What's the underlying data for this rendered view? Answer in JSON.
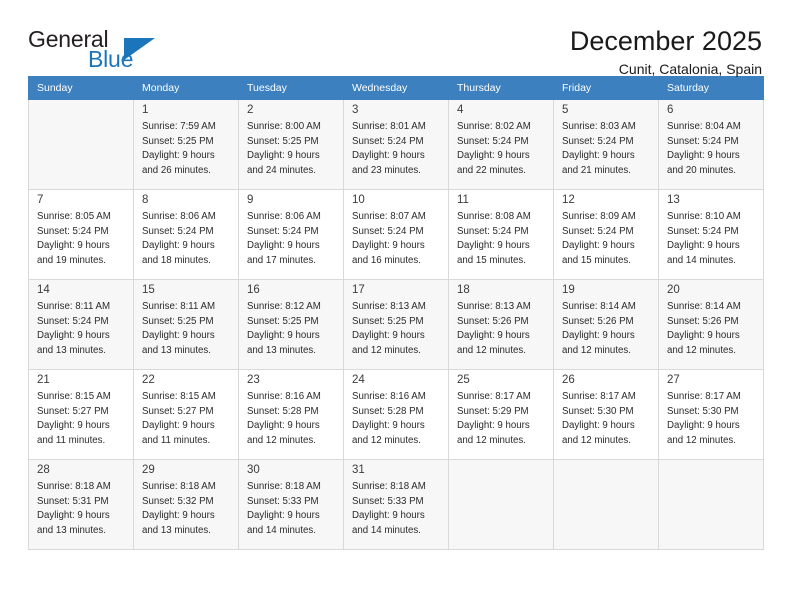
{
  "brand": {
    "name_top": "General",
    "name_bottom": "Blue",
    "accent_color": "#1b75bb"
  },
  "header": {
    "title": "December 2025",
    "subtitle": "Cunit, Catalonia, Spain"
  },
  "calendar": {
    "header_bg": "#3c80c0",
    "weekday_headers": [
      "Sunday",
      "Monday",
      "Tuesday",
      "Wednesday",
      "Thursday",
      "Friday",
      "Saturday"
    ],
    "weeks": [
      [
        {
          "day": ""
        },
        {
          "day": "1",
          "sunrise": "Sunrise: 7:59 AM",
          "sunset": "Sunset: 5:25 PM",
          "daylight_line1": "Daylight: 9 hours",
          "daylight_line2": "and 26 minutes."
        },
        {
          "day": "2",
          "sunrise": "Sunrise: 8:00 AM",
          "sunset": "Sunset: 5:25 PM",
          "daylight_line1": "Daylight: 9 hours",
          "daylight_line2": "and 24 minutes."
        },
        {
          "day": "3",
          "sunrise": "Sunrise: 8:01 AM",
          "sunset": "Sunset: 5:24 PM",
          "daylight_line1": "Daylight: 9 hours",
          "daylight_line2": "and 23 minutes."
        },
        {
          "day": "4",
          "sunrise": "Sunrise: 8:02 AM",
          "sunset": "Sunset: 5:24 PM",
          "daylight_line1": "Daylight: 9 hours",
          "daylight_line2": "and 22 minutes."
        },
        {
          "day": "5",
          "sunrise": "Sunrise: 8:03 AM",
          "sunset": "Sunset: 5:24 PM",
          "daylight_line1": "Daylight: 9 hours",
          "daylight_line2": "and 21 minutes."
        },
        {
          "day": "6",
          "sunrise": "Sunrise: 8:04 AM",
          "sunset": "Sunset: 5:24 PM",
          "daylight_line1": "Daylight: 9 hours",
          "daylight_line2": "and 20 minutes."
        }
      ],
      [
        {
          "day": "7",
          "sunrise": "Sunrise: 8:05 AM",
          "sunset": "Sunset: 5:24 PM",
          "daylight_line1": "Daylight: 9 hours",
          "daylight_line2": "and 19 minutes."
        },
        {
          "day": "8",
          "sunrise": "Sunrise: 8:06 AM",
          "sunset": "Sunset: 5:24 PM",
          "daylight_line1": "Daylight: 9 hours",
          "daylight_line2": "and 18 minutes."
        },
        {
          "day": "9",
          "sunrise": "Sunrise: 8:06 AM",
          "sunset": "Sunset: 5:24 PM",
          "daylight_line1": "Daylight: 9 hours",
          "daylight_line2": "and 17 minutes."
        },
        {
          "day": "10",
          "sunrise": "Sunrise: 8:07 AM",
          "sunset": "Sunset: 5:24 PM",
          "daylight_line1": "Daylight: 9 hours",
          "daylight_line2": "and 16 minutes."
        },
        {
          "day": "11",
          "sunrise": "Sunrise: 8:08 AM",
          "sunset": "Sunset: 5:24 PM",
          "daylight_line1": "Daylight: 9 hours",
          "daylight_line2": "and 15 minutes."
        },
        {
          "day": "12",
          "sunrise": "Sunrise: 8:09 AM",
          "sunset": "Sunset: 5:24 PM",
          "daylight_line1": "Daylight: 9 hours",
          "daylight_line2": "and 15 minutes."
        },
        {
          "day": "13",
          "sunrise": "Sunrise: 8:10 AM",
          "sunset": "Sunset: 5:24 PM",
          "daylight_line1": "Daylight: 9 hours",
          "daylight_line2": "and 14 minutes."
        }
      ],
      [
        {
          "day": "14",
          "sunrise": "Sunrise: 8:11 AM",
          "sunset": "Sunset: 5:24 PM",
          "daylight_line1": "Daylight: 9 hours",
          "daylight_line2": "and 13 minutes."
        },
        {
          "day": "15",
          "sunrise": "Sunrise: 8:11 AM",
          "sunset": "Sunset: 5:25 PM",
          "daylight_line1": "Daylight: 9 hours",
          "daylight_line2": "and 13 minutes."
        },
        {
          "day": "16",
          "sunrise": "Sunrise: 8:12 AM",
          "sunset": "Sunset: 5:25 PM",
          "daylight_line1": "Daylight: 9 hours",
          "daylight_line2": "and 13 minutes."
        },
        {
          "day": "17",
          "sunrise": "Sunrise: 8:13 AM",
          "sunset": "Sunset: 5:25 PM",
          "daylight_line1": "Daylight: 9 hours",
          "daylight_line2": "and 12 minutes."
        },
        {
          "day": "18",
          "sunrise": "Sunrise: 8:13 AM",
          "sunset": "Sunset: 5:26 PM",
          "daylight_line1": "Daylight: 9 hours",
          "daylight_line2": "and 12 minutes."
        },
        {
          "day": "19",
          "sunrise": "Sunrise: 8:14 AM",
          "sunset": "Sunset: 5:26 PM",
          "daylight_line1": "Daylight: 9 hours",
          "daylight_line2": "and 12 minutes."
        },
        {
          "day": "20",
          "sunrise": "Sunrise: 8:14 AM",
          "sunset": "Sunset: 5:26 PM",
          "daylight_line1": "Daylight: 9 hours",
          "daylight_line2": "and 12 minutes."
        }
      ],
      [
        {
          "day": "21",
          "sunrise": "Sunrise: 8:15 AM",
          "sunset": "Sunset: 5:27 PM",
          "daylight_line1": "Daylight: 9 hours",
          "daylight_line2": "and 11 minutes."
        },
        {
          "day": "22",
          "sunrise": "Sunrise: 8:15 AM",
          "sunset": "Sunset: 5:27 PM",
          "daylight_line1": "Daylight: 9 hours",
          "daylight_line2": "and 11 minutes."
        },
        {
          "day": "23",
          "sunrise": "Sunrise: 8:16 AM",
          "sunset": "Sunset: 5:28 PM",
          "daylight_line1": "Daylight: 9 hours",
          "daylight_line2": "and 12 minutes."
        },
        {
          "day": "24",
          "sunrise": "Sunrise: 8:16 AM",
          "sunset": "Sunset: 5:28 PM",
          "daylight_line1": "Daylight: 9 hours",
          "daylight_line2": "and 12 minutes."
        },
        {
          "day": "25",
          "sunrise": "Sunrise: 8:17 AM",
          "sunset": "Sunset: 5:29 PM",
          "daylight_line1": "Daylight: 9 hours",
          "daylight_line2": "and 12 minutes."
        },
        {
          "day": "26",
          "sunrise": "Sunrise: 8:17 AM",
          "sunset": "Sunset: 5:30 PM",
          "daylight_line1": "Daylight: 9 hours",
          "daylight_line2": "and 12 minutes."
        },
        {
          "day": "27",
          "sunrise": "Sunrise: 8:17 AM",
          "sunset": "Sunset: 5:30 PM",
          "daylight_line1": "Daylight: 9 hours",
          "daylight_line2": "and 12 minutes."
        }
      ],
      [
        {
          "day": "28",
          "sunrise": "Sunrise: 8:18 AM",
          "sunset": "Sunset: 5:31 PM",
          "daylight_line1": "Daylight: 9 hours",
          "daylight_line2": "and 13 minutes."
        },
        {
          "day": "29",
          "sunrise": "Sunrise: 8:18 AM",
          "sunset": "Sunset: 5:32 PM",
          "daylight_line1": "Daylight: 9 hours",
          "daylight_line2": "and 13 minutes."
        },
        {
          "day": "30",
          "sunrise": "Sunrise: 8:18 AM",
          "sunset": "Sunset: 5:33 PM",
          "daylight_line1": "Daylight: 9 hours",
          "daylight_line2": "and 14 minutes."
        },
        {
          "day": "31",
          "sunrise": "Sunrise: 8:18 AM",
          "sunset": "Sunset: 5:33 PM",
          "daylight_line1": "Daylight: 9 hours",
          "daylight_line2": "and 14 minutes."
        },
        {
          "day": ""
        },
        {
          "day": ""
        },
        {
          "day": ""
        }
      ]
    ]
  }
}
